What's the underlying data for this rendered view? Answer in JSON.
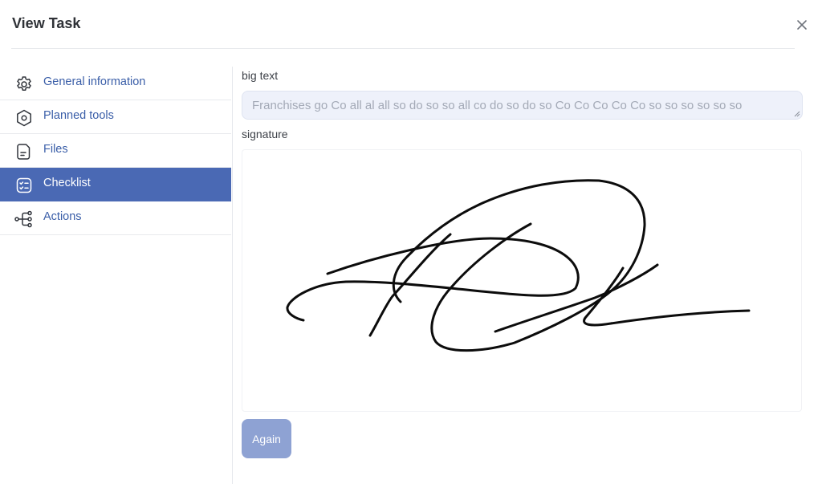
{
  "header": {
    "title": "View Task",
    "close_icon": "close-icon"
  },
  "sidebar": {
    "active_color": "#4a69b4",
    "items": [
      {
        "label": "General information",
        "icon": "gear-icon",
        "active": false
      },
      {
        "label": "Planned tools",
        "icon": "hexagon-nut-icon",
        "active": false
      },
      {
        "label": "Files",
        "icon": "file-icon",
        "active": false
      },
      {
        "label": "Checklist",
        "icon": "checklist-icon",
        "active": true
      },
      {
        "label": "Actions",
        "icon": "flow-branch-icon",
        "active": false
      }
    ]
  },
  "main": {
    "big_text": {
      "label": "big text",
      "value": "Franchises go Co all al all so do so so all co do so do so Co Co Co Co Co so so so so so so"
    },
    "signature": {
      "label": "signature"
    },
    "again_button": {
      "label": "Again"
    }
  }
}
